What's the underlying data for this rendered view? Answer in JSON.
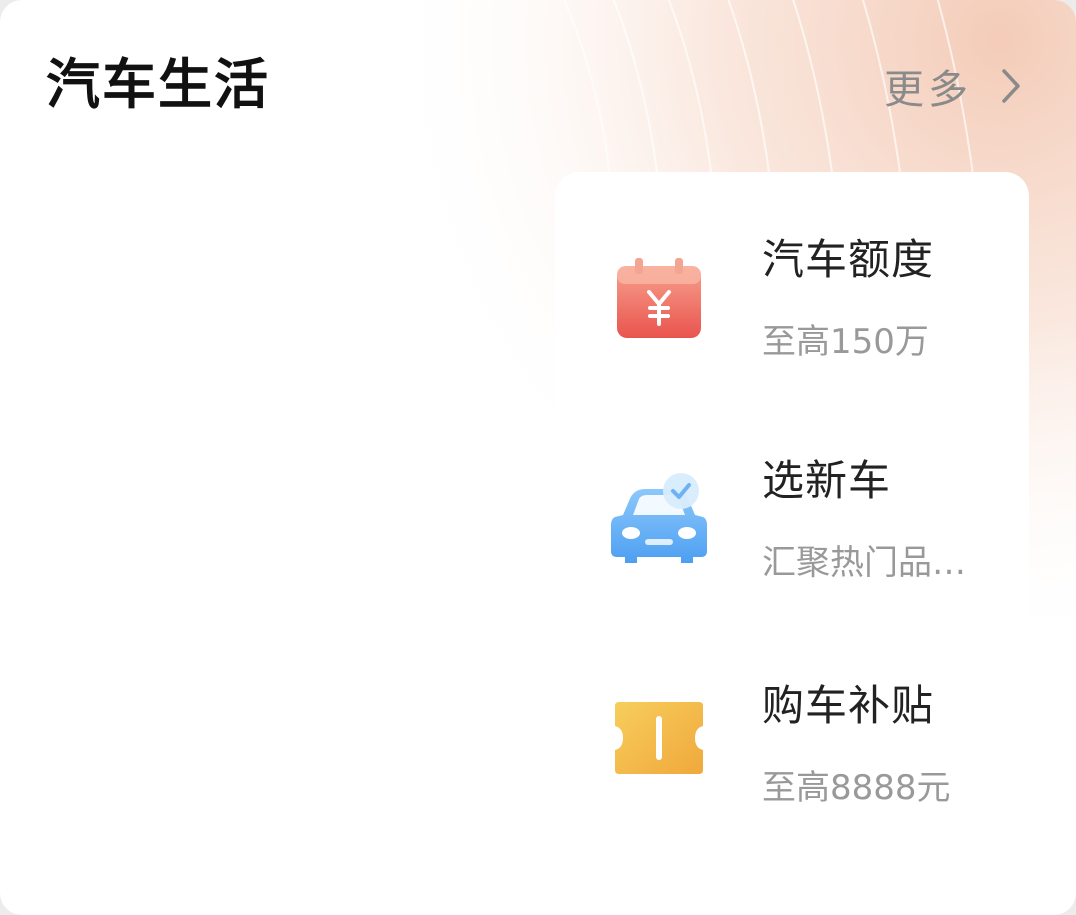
{
  "header": {
    "title": "汽车生活",
    "more_label": "更多"
  },
  "items": [
    {
      "title": "汽车额度",
      "subtitle": "至高150万",
      "icon": "calendar-yuan-icon"
    },
    {
      "title": "选新车",
      "subtitle": "汇聚热门品牌新车",
      "icon": "car-check-icon"
    },
    {
      "title": "购车补贴",
      "subtitle": "至高8888元",
      "icon": "ticket-icon"
    }
  ],
  "colors": {
    "accent_glow": "#f6d3c2",
    "title_text": "#111111",
    "muted_text": "#8a8a8a",
    "sub_text": "#999999",
    "red_icon": "#ee5a52",
    "blue_icon": "#5aaaf5",
    "yellow_icon": "#f2b443"
  }
}
